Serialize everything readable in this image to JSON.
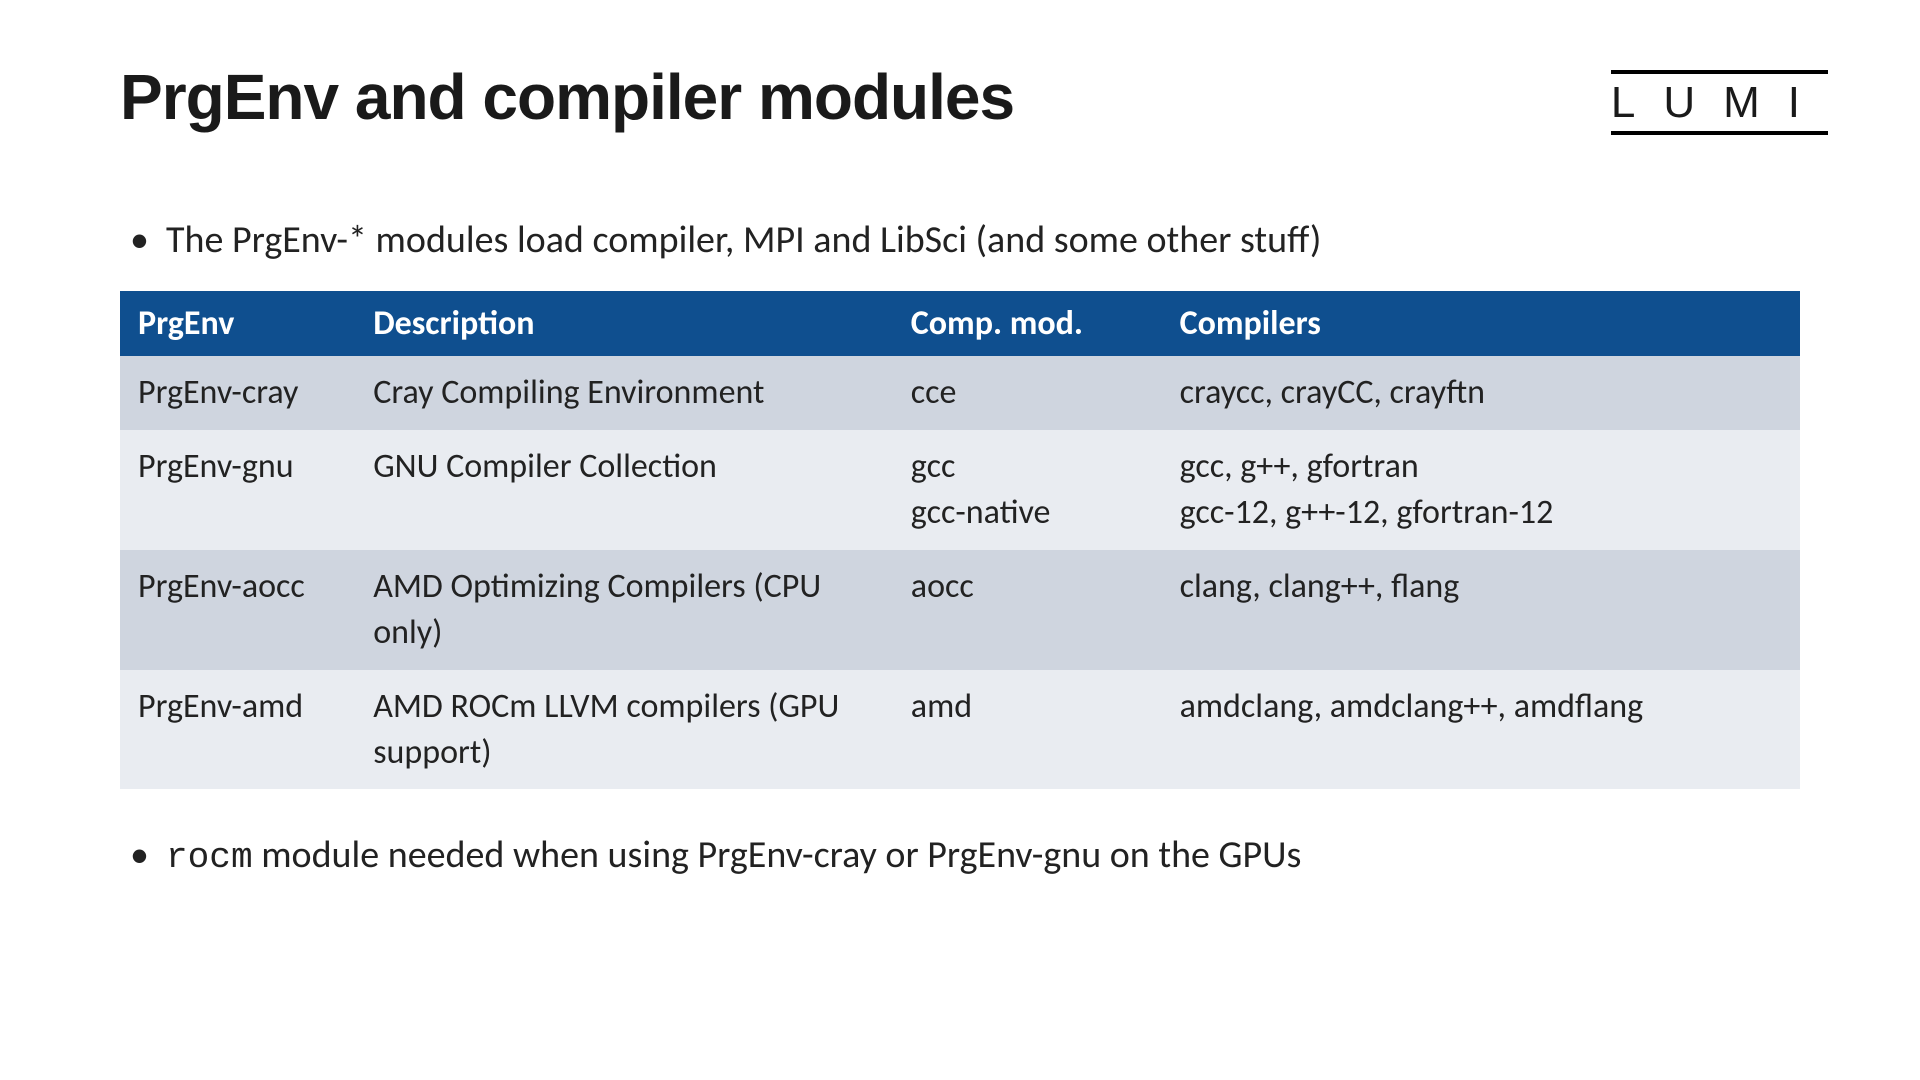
{
  "title": "PrgEnv and compiler modules",
  "logo_text": "LUMI",
  "bullet_top": "The PrgEnv-* modules load compiler, MPI and LibSci (and some other stuff)",
  "bullet_bottom_code": "rocm",
  "bullet_bottom_rest": " module needed when using PrgEnv-cray or PrgEnv-gnu on the GPUs",
  "table": {
    "headers": {
      "c1": "PrgEnv",
      "c2": "Description",
      "c3": "Comp. mod.",
      "c4": "Compilers"
    },
    "rows": [
      {
        "prgenv": "PrgEnv-cray",
        "desc": "Cray Compiling Environment",
        "mod_a": "cce",
        "mod_b": "",
        "comp_a": "craycc, crayCC, crayftn",
        "comp_b": ""
      },
      {
        "prgenv": "PrgEnv-gnu",
        "desc": "GNU Compiler Collection",
        "mod_a": "gcc",
        "mod_b": "gcc-native",
        "comp_a": "gcc, g++, gfortran",
        "comp_b": "gcc-12, g++-12, gfortran-12"
      },
      {
        "prgenv": "PrgEnv-aocc",
        "desc": "AMD Optimizing Compilers (CPU only)",
        "mod_a": "aocc",
        "mod_b": "",
        "comp_a": "clang, clang++, flang",
        "comp_b": ""
      },
      {
        "prgenv": "PrgEnv-amd",
        "desc": "AMD ROCm LLVM compilers (GPU support)",
        "mod_a": "amd",
        "mod_b": "",
        "comp_a": "amdclang, amdclang++, amdflang",
        "comp_b": ""
      }
    ]
  }
}
